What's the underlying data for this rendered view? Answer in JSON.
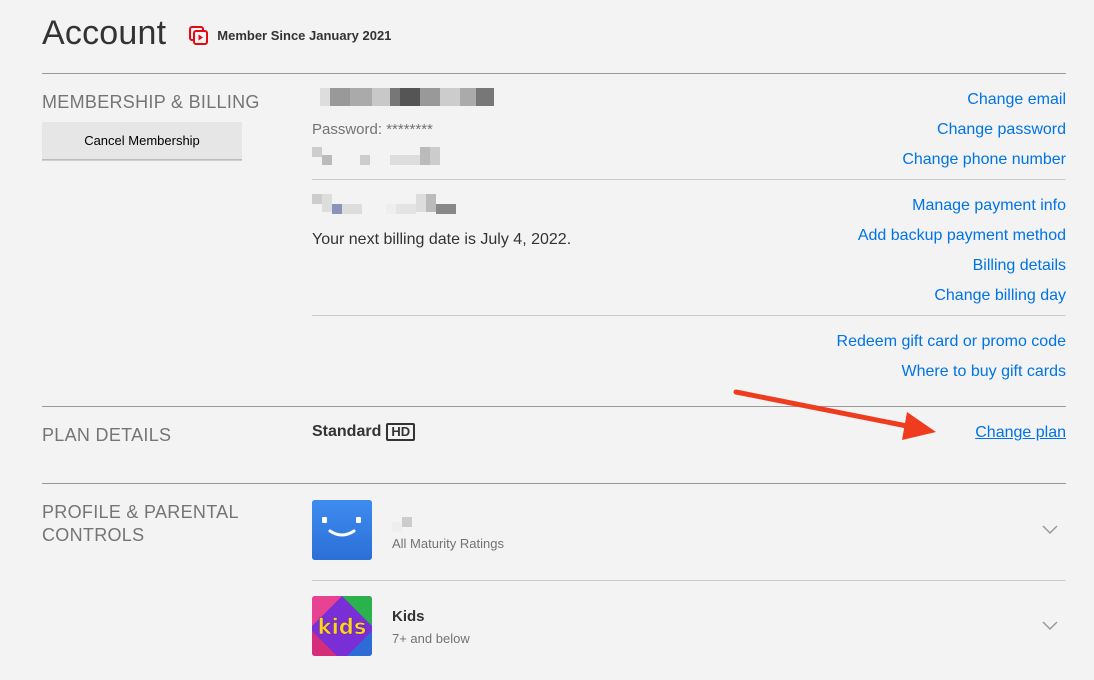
{
  "header": {
    "title": "Account",
    "member_since": "Member Since January 2021"
  },
  "membership": {
    "section_label": "MEMBERSHIP & BILLING",
    "cancel_label": "Cancel Membership",
    "password_text": "Password: ********",
    "billing_text": "Your next billing date is July 4, 2022.",
    "links_account": [
      "Change email",
      "Change password",
      "Change phone number"
    ],
    "links_payment": [
      "Manage payment info",
      "Add backup payment method",
      "Billing details",
      "Change billing day"
    ],
    "links_gift": [
      "Redeem gift card or promo code",
      "Where to buy gift cards"
    ]
  },
  "plan": {
    "section_label": "PLAN DETAILS",
    "name": "Standard",
    "badge": "HD",
    "change_label": "Change plan"
  },
  "profiles": {
    "section_label": "PROFILE & PARENTAL CONTROLS",
    "items": [
      {
        "name": "",
        "sub": "All Maturity Ratings",
        "avatar": "smiley-avatar"
      },
      {
        "name": "Kids",
        "sub": "7+ and below",
        "avatar": "kids-avatar"
      }
    ]
  },
  "icons": {
    "member": "membership-card-icon",
    "chevron": "chevron-down-icon",
    "arrow": "annotation-arrow"
  },
  "colors": {
    "background": "#f3f3f3",
    "link": "#0073e6",
    "accent": "#e50914",
    "arrow": "#f03c1e",
    "avatar_blue": "#2f80ed"
  }
}
